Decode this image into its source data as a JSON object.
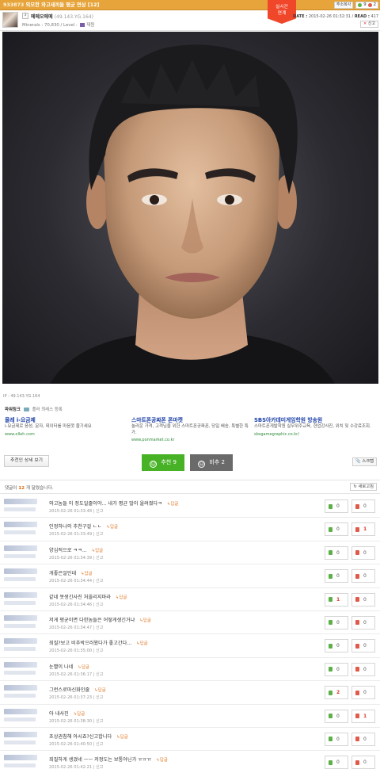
{
  "post": {
    "id": "933873",
    "title": "외모한 와고새끼들 평균 면상",
    "comment_count_badge": "[12]",
    "copy_url": "주소복사",
    "likes": "9",
    "dislikes": "2",
    "live_badge_line1": "실시간",
    "live_badge_line2": "연계"
  },
  "author": {
    "level_icon": "3",
    "name": "메메오메메",
    "ip": "(49.143.YG.164)",
    "minerals": "Minerals : 70,830 / Level :",
    "level_name": "재원"
  },
  "meta": {
    "date_label": "DATE :",
    "date": "2015-02-26 01:32:31",
    "read_label": "READ :",
    "read": "417",
    "report": "신고"
  },
  "ip_line": "IP : 49.143.YG.164",
  "ads": {
    "header": "파워링크",
    "header_sub": "플러 최레스 등록",
    "items": [
      {
        "title": "올레 i-요금제",
        "desc": "i-요금제로 음성, 문자, 데이터를 마음껏 즐기세요",
        "url": "www.olleh.com"
      },
      {
        "title": "스마트폰공짜폰 폰마켓",
        "desc": "놀라운 가격, 고객님을 위한 스마트폰공짜폰, 당일 배송, 특별한 특가.",
        "url": "www.ponmarket.co.kr"
      },
      {
        "title": "SBS아카데미게임학원 방송원",
        "desc": "스마트폰게발학원 실무위주교육, 현업강사진, 위치 및 수강료조회.",
        "url": "sbsgamegraphic.co.kr/"
      }
    ]
  },
  "actions": {
    "recommenders": "추천인 상세 보기",
    "upvote": "추천",
    "upvote_count": "9",
    "downvote": "비추",
    "downvote_count": "2",
    "scrap": "스크랩"
  },
  "comments_header": {
    "prefix": "댓글이",
    "count": "12",
    "suffix": "개 달렸습니다.",
    "refresh": "새로고침"
  },
  "reply_label": "답글",
  "comments": [
    {
      "text": "와고놈들 이 정도일줄이야... 내가 평균 많이 올려줬다ㅋ",
      "time": "2015-02-26 01:33:48 | 신고",
      "up": "0",
      "down": "0"
    },
    {
      "text": "인정하나의 추천구걸 ㄴㄴ",
      "time": "2015-02-26 01:33:49 | 신고",
      "up": "0",
      "down": "1"
    },
    {
      "text": "양심적으로 ㅋㅋ...",
      "time": "2015-02-26 01:34:39 | 신고",
      "up": "0",
      "down": "0"
    },
    {
      "text": "개좋은얼인데",
      "time": "2015-02-26 01:34:44 | 신고",
      "up": "0",
      "down": "0"
    },
    {
      "text": "같네 못생긴사진 처올리지마라",
      "time": "2015-02-26 01:34:46 | 신고",
      "up": "1",
      "down": "0"
    },
    {
      "text": "저게 평균이면 다한놈들은 어떻게생긴거냐",
      "time": "2015-02-26 01:34:47 | 신고",
      "up": "0",
      "down": "0"
    },
    {
      "text": "죄질?보고 비추박으러왔다가 좋고간다...",
      "time": "2015-02-26 01:35:00 | 신고",
      "up": "0",
      "down": "0"
    },
    {
      "text": "눈빨이 나네",
      "time": "2015-02-26 01:36:17 | 신고",
      "up": "0",
      "down": "0"
    },
    {
      "text": "그런스로마신화인줄",
      "time": "2015-02-26 01:37:23 | 신고",
      "up": "2",
      "down": "0"
    },
    {
      "text": "아 내사진",
      "time": "2015-02-26 01:38:30 | 신고",
      "up": "0",
      "down": "1"
    },
    {
      "text": "초상권침해 아시죠?신고합니다",
      "time": "2015-02-26 01:40:50 | 신고",
      "up": "0",
      "down": "0"
    },
    {
      "text": "죄질하게 생겼네 ㅡㅡ 저정도는 보통아닌가 ㅠㅠㅠ",
      "time": "2015-02-26 01:42:21 | 신고",
      "up": "0",
      "down": "0"
    }
  ]
}
